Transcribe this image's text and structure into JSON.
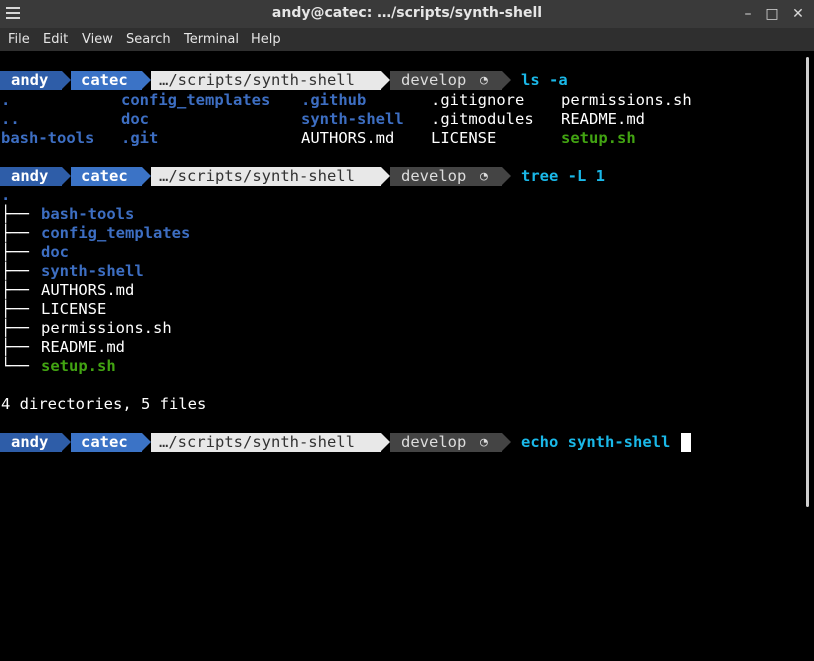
{
  "window": {
    "title": "andy@catec: …/scripts/synth-shell",
    "minimize": "–",
    "maximize": "□",
    "close": "✕"
  },
  "menu": [
    "File",
    "Edit",
    "View",
    "Search",
    "Terminal",
    "Help"
  ],
  "prompt": {
    "user": "andy",
    "host": "catec",
    "path": "…/scripts/synth-shell",
    "branch": "develop",
    "branch_icon": "◔",
    "colors": {
      "user_bg": "#2e5da8",
      "host_bg": "#3b73c6",
      "path_bg": "#e8e8e8",
      "git_bg": "#444444"
    }
  },
  "commands": [
    "ls -a",
    "tree -L 1",
    "echo synth-shell"
  ],
  "ls_output": [
    [
      ".",
      "config_templates",
      ".github",
      ".gitignore",
      "permissions.sh"
    ],
    [
      "..",
      "doc",
      "synth-shell",
      ".gitmodules",
      "README.md"
    ],
    [
      "bash-tools",
      ".git",
      "AUTHORS.md",
      "LICENSE",
      "setup.sh"
    ]
  ],
  "tree": {
    "root": ".",
    "branch_glyph": "├──",
    "last_glyph": "└──",
    "entries": [
      "bash-tools",
      "config_templates",
      "doc",
      "synth-shell",
      "AUTHORS.md",
      "LICENSE",
      "permissions.sh",
      "README.md",
      "setup.sh"
    ],
    "summary": "4 directories, 5 files"
  }
}
